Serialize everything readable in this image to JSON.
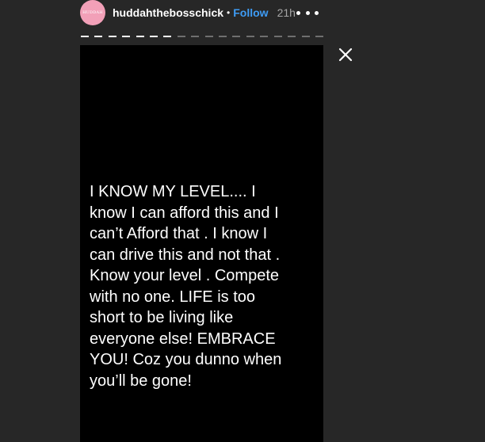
{
  "header": {
    "avatar_label": "HUDDAH",
    "username": "huddahthebosschick",
    "separator": "•",
    "follow_label": "Follow",
    "timestamp": "21h",
    "more_icon": "more-horizontal-icon"
  },
  "progress": {
    "total_segments": 18,
    "completed_segments": 7
  },
  "story": {
    "lines": [
      "I KNOW MY LEVEL.... I",
      "know I can afford this and I",
      "can’t Afford that . I know I",
      "can drive this and not that .",
      "Know your level . Compete",
      "with no one. LIFE is too",
      "short to be living like",
      "everyone else! EMBRACE",
      "YOU! Coz you dunno when",
      "you’ll be gone!"
    ]
  },
  "controls": {
    "close_icon": "close-icon"
  },
  "colors": {
    "page_background": "#272727",
    "story_background": "#000000",
    "follow_color": "#3e9cf5",
    "avatar_color": "#f2a0b8"
  }
}
